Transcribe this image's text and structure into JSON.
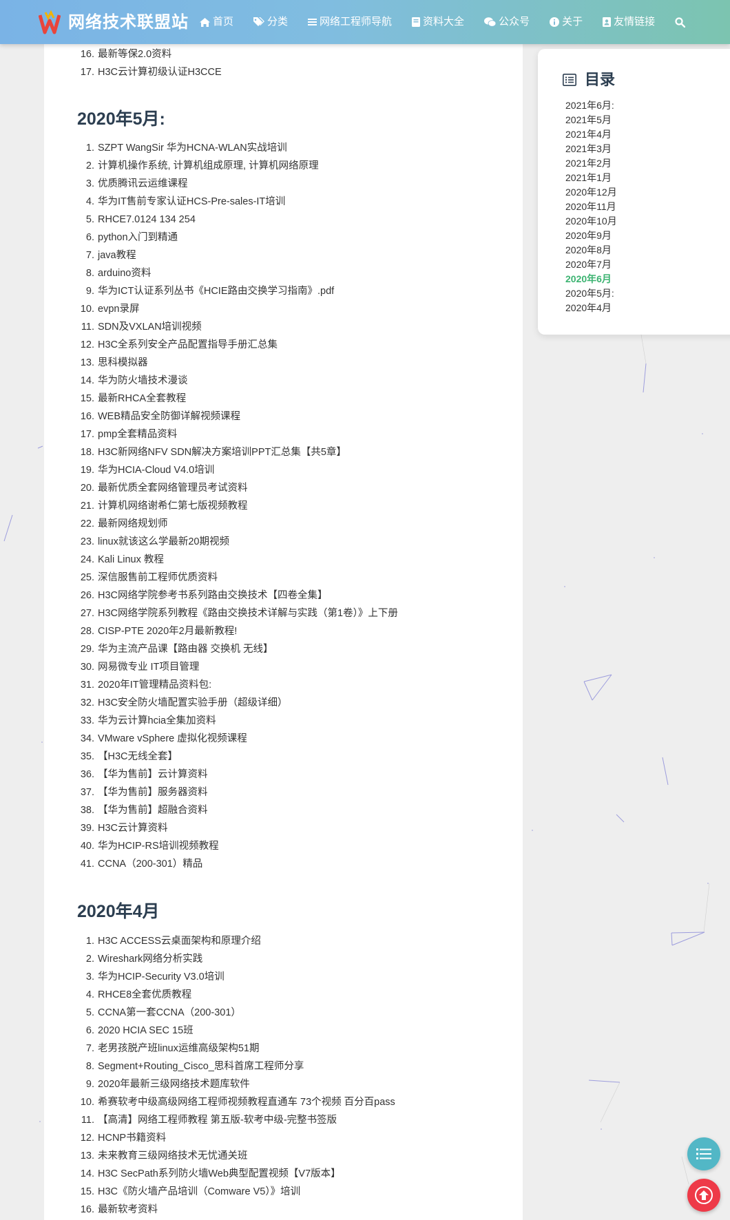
{
  "header": {
    "site_title": "网络技术联盟站",
    "logo_icon": "w-logo-icon",
    "nav": [
      {
        "label": "首页",
        "icon": "home-icon"
      },
      {
        "label": "分类",
        "icon": "tags-icon"
      },
      {
        "label": "网络工程师导航",
        "icon": "list-icon"
      },
      {
        "label": "资料大全",
        "icon": "book-icon"
      },
      {
        "label": "公众号",
        "icon": "wechat-icon"
      },
      {
        "label": "关于",
        "icon": "info-icon"
      },
      {
        "label": "友情链接",
        "icon": "address-book-icon"
      }
    ],
    "search_icon": "search-icon"
  },
  "content": {
    "top_items": [
      {
        "num": "16.",
        "text": "最新等保2.0资料"
      },
      {
        "num": "17.",
        "text": "H3C云计算初级认证H3CCE"
      }
    ],
    "section_may_title": "2020年5月:",
    "section_may_items": [
      {
        "num": "1.",
        "text": "SZPT WangSir 华为HCNA-WLAN实战培训"
      },
      {
        "num": "2.",
        "text": "计算机操作系统, 计算机组成原理, 计算机网络原理"
      },
      {
        "num": "3.",
        "text": "优质腾讯云运维课程"
      },
      {
        "num": "4.",
        "text": "华为IT售前专家认证HCS-Pre-sales-IT培训"
      },
      {
        "num": "5.",
        "text": "RHCE7.0124 134 254"
      },
      {
        "num": "6.",
        "text": "python入门到精通"
      },
      {
        "num": "7.",
        "text": "java教程"
      },
      {
        "num": "8.",
        "text": "arduino资料"
      },
      {
        "num": "9.",
        "text": "华为ICT认证系列丛书《HCIE路由交换学习指南》.pdf"
      },
      {
        "num": "10.",
        "text": "evpn录屏"
      },
      {
        "num": "11.",
        "text": "SDN及VXLAN培训视频"
      },
      {
        "num": "12.",
        "text": "H3C全系列安全产品配置指导手册汇总集"
      },
      {
        "num": "13.",
        "text": "思科模拟器"
      },
      {
        "num": "14.",
        "text": "华为防火墙技术漫谈"
      },
      {
        "num": "15.",
        "text": "最新RHCA全套教程"
      },
      {
        "num": "16.",
        "text": "WEB精品安全防御详解视频课程"
      },
      {
        "num": "17.",
        "text": "pmp全套精品资料"
      },
      {
        "num": "18.",
        "text": "H3C新网络NFV SDN解决方案培训PPT汇总集【共5章】"
      },
      {
        "num": "19.",
        "text": "华为HCIA-Cloud V4.0培训"
      },
      {
        "num": "20.",
        "text": "最新优质全套网络管理员考试资料"
      },
      {
        "num": "21.",
        "text": "计算机网络谢希仁第七版视频教程"
      },
      {
        "num": "22.",
        "text": "最新网络规划师"
      },
      {
        "num": "23.",
        "text": "linux就该这么学最新20期视频"
      },
      {
        "num": "24.",
        "text": "Kali Linux 教程"
      },
      {
        "num": "25.",
        "text": "深信服售前工程师优质资料"
      },
      {
        "num": "26.",
        "text": "H3C网络学院参考书系列路由交换技术【四卷全集】"
      },
      {
        "num": "27.",
        "text": "H3C网络学院系列教程《路由交换技术详解与实践（第1卷）》上下册"
      },
      {
        "num": "28.",
        "text": "CISP-PTE 2020年2月最新教程!"
      },
      {
        "num": "29.",
        "text": "华为主流产品课【路由器 交换机 无线】"
      },
      {
        "num": "30.",
        "text": "网易微专业 IT项目管理"
      },
      {
        "num": "31.",
        "text": "2020年IT管理精品资料包:"
      },
      {
        "num": "32.",
        "text": "H3C安全防火墙配置实验手册（超级详细）"
      },
      {
        "num": "33.",
        "text": "华为云计算hcia全集加资料"
      },
      {
        "num": "34.",
        "text": "VMware vSphere 虚拟化视频课程"
      },
      {
        "num": "35.",
        "text": "【H3C无线全套】"
      },
      {
        "num": "36.",
        "text": "【华为售前】云计算资料"
      },
      {
        "num": "37.",
        "text": "【华为售前】服务器资料"
      },
      {
        "num": "38.",
        "text": "【华为售前】超融合资料"
      },
      {
        "num": "39.",
        "text": "H3C云计算资料"
      },
      {
        "num": "40.",
        "text": "华为HCIP-RS培训视频教程"
      },
      {
        "num": "41.",
        "text": "CCNA（200-301）精品"
      }
    ],
    "section_apr_title": "2020年4月",
    "section_apr_items": [
      {
        "num": "1.",
        "text": "H3C ACCESS云桌面架构和原理介绍"
      },
      {
        "num": "2.",
        "text": "Wireshark网络分析实践"
      },
      {
        "num": "3.",
        "text": "华为HCIP-Security V3.0培训"
      },
      {
        "num": "4.",
        "text": "RHCE8全套优质教程"
      },
      {
        "num": "5.",
        "text": "CCNA第一套CCNA（200-301）"
      },
      {
        "num": "6.",
        "text": "2020 HCIA SEC 15班"
      },
      {
        "num": "7.",
        "text": "老男孩脱产班linux运维高级架构51期"
      },
      {
        "num": "8.",
        "text": "Segment+Routing_Cisco_思科首席工程师分享"
      },
      {
        "num": "9.",
        "text": "2020年最新三级网络技术题库软件"
      },
      {
        "num": "10.",
        "text": "希赛软考中级高级网络工程师视频教程直通车 73个视频 百分百pass"
      },
      {
        "num": "11.",
        "text": "【高清】网络工程师教程 第五版-软考中级-完整书签版"
      },
      {
        "num": "12.",
        "text": "HCNP书籍资料"
      },
      {
        "num": "13.",
        "text": "未来教育三级网络技术无忧通关班"
      },
      {
        "num": "14.",
        "text": "H3C SecPath系列防火墙Web典型配置视频【V7版本】"
      },
      {
        "num": "15.",
        "text": "H3C《防火墙产品培训（Comware V5）》培训"
      },
      {
        "num": "16.",
        "text": "最新软考资料"
      }
    ]
  },
  "toc": {
    "title": "目录",
    "icon": "toc-list-icon",
    "items": [
      "2021年6月:",
      "2021年5月",
      "2021年4月",
      "2021年3月",
      "2021年2月",
      "2021年1月",
      "2020年12月",
      "2020年11月",
      "2020年10月",
      "2020年9月",
      "2020年8月",
      "2020年7月",
      "2020年6月",
      "2020年5月:",
      "2020年4月"
    ],
    "active": "2020年6月"
  },
  "floating": {
    "toc_button_icon": "list-icon",
    "back_to_top_icon": "arrow-up-icon"
  },
  "colors": {
    "header_gradient_start": "#7ab3e6",
    "header_gradient_end": "#7cc4b0",
    "active_toc": "#3cb371",
    "heading": "#2c3e50",
    "fab_toc": "#52b7c6",
    "fab_top": "#ee3a48"
  }
}
